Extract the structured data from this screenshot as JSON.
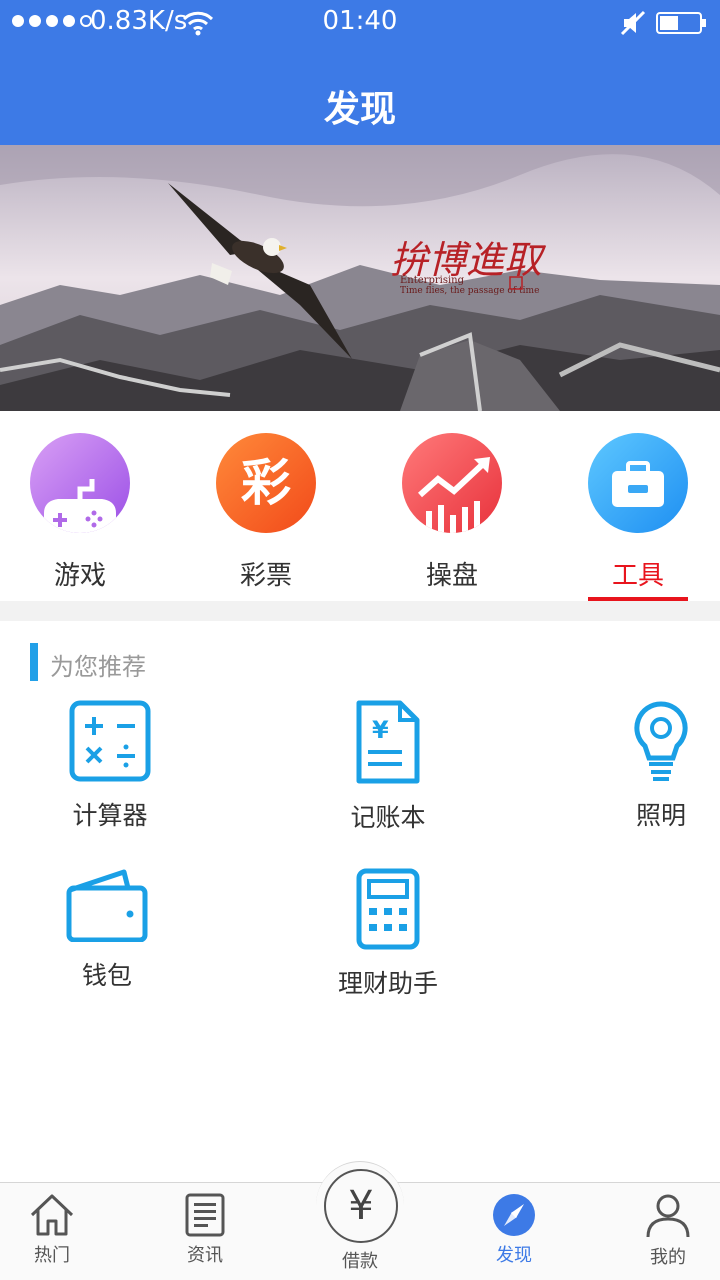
{
  "status_bar": {
    "network_speed": "0.83K/s",
    "time": "01:40"
  },
  "header": {
    "title": "发现"
  },
  "banner": {
    "calligraphy": "拚博進取",
    "caption_en": "Enterprising",
    "caption_sub": "Time flies, the passage of time"
  },
  "categories": [
    {
      "label": "游戏",
      "icon": "gamepad-icon"
    },
    {
      "label": "彩票",
      "icon": "lottery-icon",
      "glyph": "彩"
    },
    {
      "label": "操盘",
      "icon": "trend-chart-icon"
    },
    {
      "label": "工具",
      "icon": "toolbox-icon",
      "active": true
    }
  ],
  "section": {
    "title": "为您推荐"
  },
  "tools": [
    {
      "label": "计算器",
      "icon": "calculator-icon"
    },
    {
      "label": "记账本",
      "icon": "ledger-icon"
    },
    {
      "label": "照明",
      "icon": "lightbulb-icon"
    },
    {
      "label": "钱包",
      "icon": "wallet-icon"
    },
    {
      "label": "理财助手",
      "icon": "finance-calculator-icon"
    }
  ],
  "tabbar": [
    {
      "label": "热门",
      "icon": "home-icon"
    },
    {
      "label": "资讯",
      "icon": "news-icon"
    },
    {
      "label": "借款",
      "icon": "yen-icon",
      "glyph": "¥"
    },
    {
      "label": "发现",
      "icon": "compass-icon",
      "active": true
    },
    {
      "label": "我的",
      "icon": "user-icon"
    }
  ],
  "colors": {
    "header": "#3d7ae6",
    "active_red": "#e8141d",
    "tool_blue": "#1aa0e6",
    "section_bar": "#22a0e8"
  }
}
